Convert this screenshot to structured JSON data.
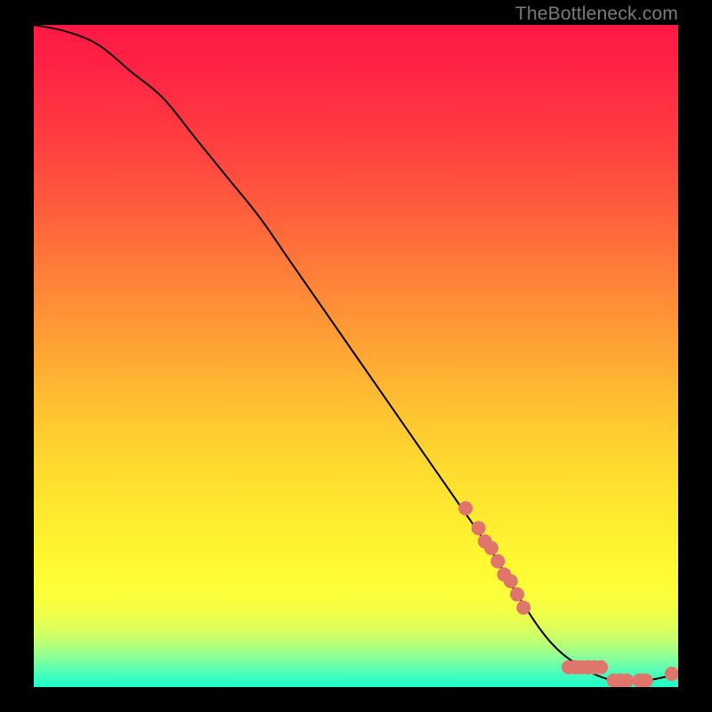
{
  "watermark": "TheBottleneck.com",
  "chart_data": {
    "type": "line",
    "title": "",
    "xlabel": "",
    "ylabel": "",
    "xlim": [
      0,
      100
    ],
    "ylim": [
      0,
      100
    ],
    "grid": false,
    "legend": false,
    "series": [
      {
        "name": "curve",
        "x": [
          0,
          5,
          10,
          15,
          20,
          25,
          30,
          35,
          40,
          45,
          50,
          55,
          60,
          65,
          70,
          72,
          75,
          80,
          85,
          90,
          95,
          100
        ],
        "y": [
          100,
          99,
          97,
          93,
          89,
          83,
          77,
          71,
          64,
          57,
          50,
          43,
          36,
          29,
          22,
          19,
          14,
          7,
          3,
          1,
          1,
          2
        ]
      }
    ],
    "markers": [
      {
        "name": "cluster-left",
        "color": "#e0766b",
        "points": [
          {
            "x": 67,
            "y": 27
          },
          {
            "x": 69,
            "y": 24
          },
          {
            "x": 70,
            "y": 22
          },
          {
            "x": 71,
            "y": 21
          },
          {
            "x": 72,
            "y": 19
          },
          {
            "x": 73,
            "y": 17
          },
          {
            "x": 74,
            "y": 16
          },
          {
            "x": 75,
            "y": 14
          },
          {
            "x": 76,
            "y": 12
          }
        ]
      },
      {
        "name": "cluster-bottom",
        "color": "#e0766b",
        "points": [
          {
            "x": 83,
            "y": 3
          },
          {
            "x": 84,
            "y": 3
          },
          {
            "x": 85,
            "y": 3
          },
          {
            "x": 86,
            "y": 3
          },
          {
            "x": 87,
            "y": 3
          },
          {
            "x": 88,
            "y": 3
          },
          {
            "x": 90,
            "y": 1
          },
          {
            "x": 91,
            "y": 1
          },
          {
            "x": 92,
            "y": 1
          },
          {
            "x": 94,
            "y": 1
          },
          {
            "x": 95,
            "y": 1
          },
          {
            "x": 99,
            "y": 2
          }
        ]
      }
    ],
    "background_gradient": {
      "stops": [
        {
          "pos": 0.0,
          "color": "#ff1945"
        },
        {
          "pos": 0.06,
          "color": "#ff2244"
        },
        {
          "pos": 0.13,
          "color": "#ff3342"
        },
        {
          "pos": 0.2,
          "color": "#ff4540"
        },
        {
          "pos": 0.27,
          "color": "#ff5b3d"
        },
        {
          "pos": 0.34,
          "color": "#ff723a"
        },
        {
          "pos": 0.41,
          "color": "#ff8a37"
        },
        {
          "pos": 0.48,
          "color": "#ffa134"
        },
        {
          "pos": 0.55,
          "color": "#ffb832"
        },
        {
          "pos": 0.61,
          "color": "#ffcb30"
        },
        {
          "pos": 0.68,
          "color": "#ffdd2f"
        },
        {
          "pos": 0.74,
          "color": "#ffea2f"
        },
        {
          "pos": 0.79,
          "color": "#fff430"
        },
        {
          "pos": 0.83,
          "color": "#fffb34"
        },
        {
          "pos": 0.86,
          "color": "#fcff3a"
        },
        {
          "pos": 0.885,
          "color": "#f2ff45"
        },
        {
          "pos": 0.905,
          "color": "#e3ff54"
        },
        {
          "pos": 0.922,
          "color": "#ceff67"
        },
        {
          "pos": 0.937,
          "color": "#b4ff7c"
        },
        {
          "pos": 0.95,
          "color": "#97ff90"
        },
        {
          "pos": 0.962,
          "color": "#79ffa2"
        },
        {
          "pos": 0.973,
          "color": "#5bffb1"
        },
        {
          "pos": 0.983,
          "color": "#40ffbc"
        },
        {
          "pos": 0.992,
          "color": "#2affc4"
        },
        {
          "pos": 1.0,
          "color": "#1fffc8"
        }
      ]
    }
  }
}
